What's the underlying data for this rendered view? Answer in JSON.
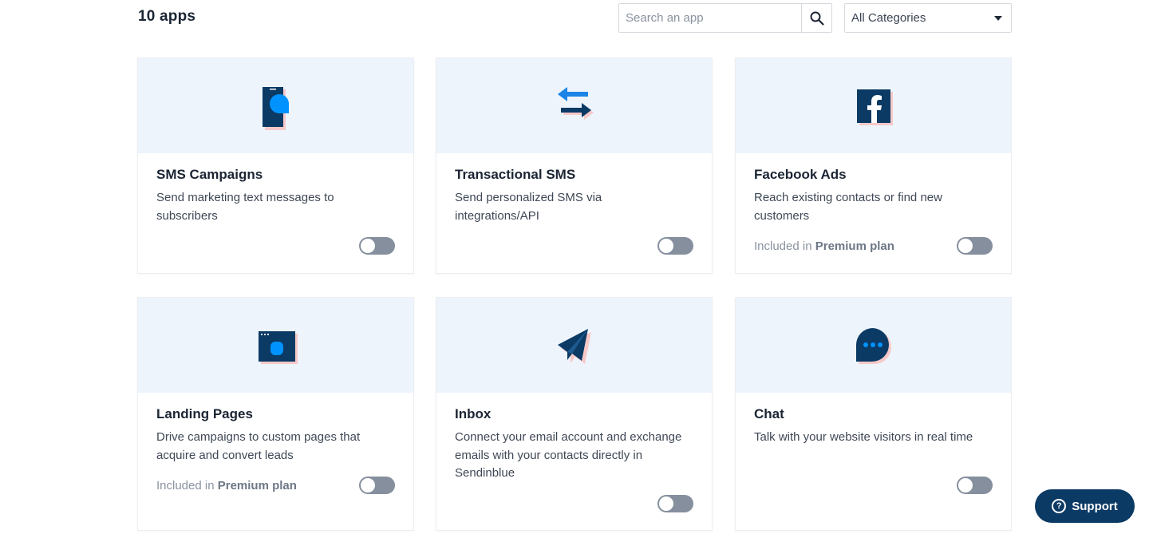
{
  "header": {
    "app_count": "10 apps",
    "search_placeholder": "Search an app",
    "category_selected": "All Categories"
  },
  "cards": [
    {
      "title": "SMS Campaigns",
      "description": "Send marketing text messages to subscribers",
      "icon": "sms-phone-icon",
      "plan_prefix": "",
      "plan_name": "",
      "enabled": false
    },
    {
      "title": "Transactional SMS",
      "description": "Send personalized SMS via integrations/API",
      "icon": "transfer-arrows-icon",
      "plan_prefix": "",
      "plan_name": "",
      "enabled": false
    },
    {
      "title": "Facebook Ads",
      "description": "Reach existing contacts or find new customers",
      "icon": "facebook-icon",
      "plan_prefix": "Included in ",
      "plan_name": "Premium plan",
      "enabled": false
    },
    {
      "title": "Landing Pages",
      "description": "Drive campaigns to custom pages that acquire and convert leads",
      "icon": "browser-window-icon",
      "plan_prefix": "Included in ",
      "plan_name": "Premium plan",
      "enabled": false
    },
    {
      "title": "Inbox",
      "description": "Connect your email account and exchange emails with your contacts directly in Sendinblue",
      "icon": "paper-plane-icon",
      "plan_prefix": "",
      "plan_name": "",
      "enabled": false
    },
    {
      "title": "Chat",
      "description": "Talk with your website visitors in real time",
      "icon": "chat-bubble-icon",
      "plan_prefix": "",
      "plan_name": "",
      "enabled": false
    }
  ],
  "support": {
    "label": "Support"
  },
  "colors": {
    "navy": "#0b3a64",
    "blue": "#0092ff",
    "hero_bg": "#edf4fc",
    "toggle_off": "#858f9e",
    "shadow_pink": "#f7c9c9"
  }
}
